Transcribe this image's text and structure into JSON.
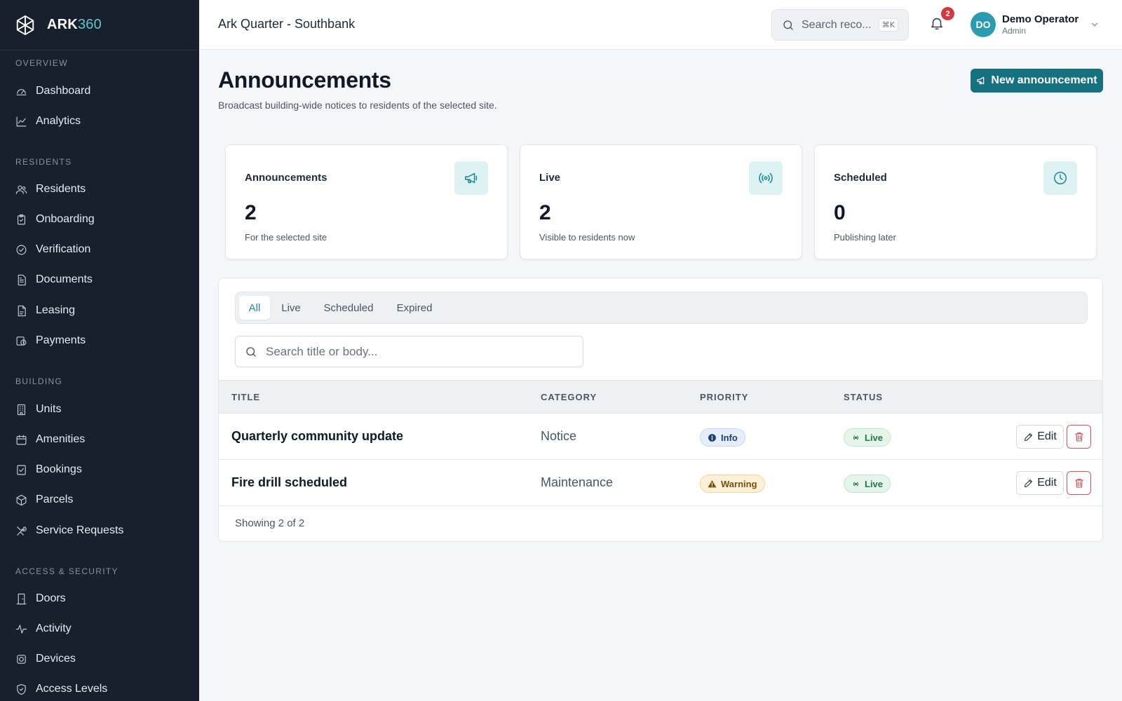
{
  "brand": {
    "name_main": "ARK",
    "name_accent": "360"
  },
  "sidebar": {
    "sections": [
      {
        "label": "OVERVIEW",
        "items": [
          {
            "label": "Dashboard",
            "icon": "gauge-icon"
          },
          {
            "label": "Analytics",
            "icon": "chart-line-icon"
          }
        ]
      },
      {
        "label": "RESIDENTS",
        "items": [
          {
            "label": "Residents",
            "icon": "users-icon"
          },
          {
            "label": "Onboarding",
            "icon": "clipboard-icon"
          },
          {
            "label": "Verification",
            "icon": "check-circle-icon"
          },
          {
            "label": "Documents",
            "icon": "file-text-icon"
          },
          {
            "label": "Leasing",
            "icon": "file-icon"
          },
          {
            "label": "Payments",
            "icon": "payment-icon"
          }
        ]
      },
      {
        "label": "BUILDING",
        "items": [
          {
            "label": "Units",
            "icon": "building-icon"
          },
          {
            "label": "Amenities",
            "icon": "calendar-icon"
          },
          {
            "label": "Bookings",
            "icon": "calendar-check-icon"
          },
          {
            "label": "Parcels",
            "icon": "package-icon"
          },
          {
            "label": "Service Requests",
            "icon": "tools-icon"
          }
        ]
      },
      {
        "label": "ACCESS & SECURITY",
        "items": [
          {
            "label": "Doors",
            "icon": "door-icon"
          },
          {
            "label": "Activity",
            "icon": "activity-icon"
          },
          {
            "label": "Devices",
            "icon": "device-icon"
          },
          {
            "label": "Access Levels",
            "icon": "shield-icon"
          }
        ]
      }
    ]
  },
  "topbar": {
    "site_title": "Ark Quarter - Southbank",
    "search_placeholder": "Search reco...",
    "search_shortcut": "⌘K",
    "notification_count": "2",
    "user": {
      "initials": "DO",
      "name": "Demo Operator",
      "role": "Admin"
    }
  },
  "page": {
    "title": "Announcements",
    "subtitle": "Broadcast building-wide notices to residents of the selected site.",
    "new_button_label": "New announcement"
  },
  "stats": [
    {
      "label": "Announcements",
      "value": "2",
      "desc": "For the selected site",
      "icon": "megaphone-icon"
    },
    {
      "label": "Live",
      "value": "2",
      "desc": "Visible to residents now",
      "icon": "broadcast-icon"
    },
    {
      "label": "Scheduled",
      "value": "0",
      "desc": "Publishing later",
      "icon": "clock-icon"
    }
  ],
  "tabs": [
    "All",
    "Live",
    "Scheduled",
    "Expired"
  ],
  "active_tab": "All",
  "list_search_placeholder": "Search title or body...",
  "table": {
    "columns": [
      "TITLE",
      "CATEGORY",
      "PRIORITY",
      "STATUS"
    ],
    "rows": [
      {
        "title": "Quarterly community update",
        "category": "Notice",
        "priority": "Info",
        "status": "Live",
        "edit_label": "Edit"
      },
      {
        "title": "Fire drill scheduled",
        "category": "Maintenance",
        "priority": "Warning",
        "status": "Live",
        "edit_label": "Edit"
      }
    ],
    "footer": "Showing 2 of 2"
  },
  "colors": {
    "sidebar_bg": "#17202c",
    "accent": "#15707f",
    "brand_accent": "#5bc6d3",
    "danger": "#d33b3b",
    "live_green": "#1c7a46",
    "info_blue": "#1d3f7a",
    "warning_amber": "#7a4e0a"
  }
}
